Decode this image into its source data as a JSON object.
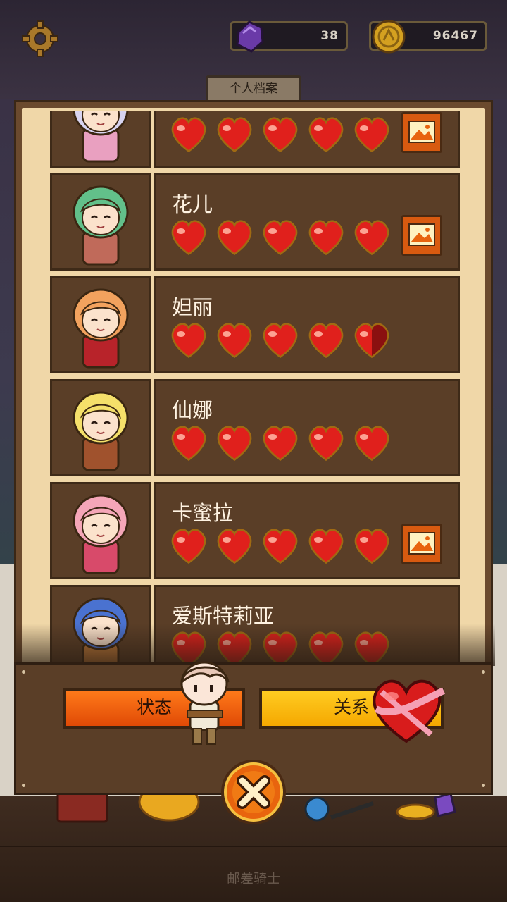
{
  "top_bar": {
    "gems": "38",
    "coins": "96467"
  },
  "tab_label": "个人档案",
  "characters": [
    {
      "name": "",
      "hearts": [
        1,
        1,
        1,
        1,
        1
      ],
      "has_gallery": true,
      "hair": "#d8d4f0",
      "accent": "#e9a0c0"
    },
    {
      "name": "花儿",
      "hearts": [
        1,
        1,
        1,
        1,
        1
      ],
      "has_gallery": true,
      "hair": "#62c08a",
      "accent": "#c06a5a"
    },
    {
      "name": "妲丽",
      "hearts": [
        1,
        1,
        1,
        1,
        0.5
      ],
      "has_gallery": false,
      "hair": "#f2a25e",
      "accent": "#b8232a"
    },
    {
      "name": "仙娜",
      "hearts": [
        1,
        1,
        1,
        1,
        1
      ],
      "has_gallery": false,
      "hair": "#f5e06a",
      "accent": "#a0522d"
    },
    {
      "name": "卡蜜拉",
      "hearts": [
        1,
        1,
        1,
        1,
        1
      ],
      "has_gallery": true,
      "hair": "#f5a6b8",
      "accent": "#d84a6a"
    },
    {
      "name": "爱斯特莉亚",
      "hearts": [
        1,
        1,
        1,
        1,
        1
      ],
      "has_gallery": false,
      "hair": "#4a72d0",
      "accent": "#c07a3a"
    }
  ],
  "buttons": {
    "status": "状态",
    "relationship": "关系"
  },
  "footer": "邮差骑士",
  "colors": {
    "heart": "#e0201c",
    "heart_outline": "#a06a12",
    "status_button": "#f0640c",
    "relationship_button": "#fbb810"
  }
}
